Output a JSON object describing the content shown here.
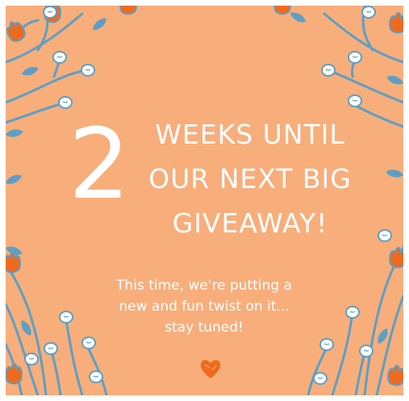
{
  "card": {
    "number": "2",
    "headline_lines": [
      "WEEKS UNTIL",
      "OUR NEXT BIG",
      "GIVEAWAY!"
    ],
    "subtext_lines": [
      "This time, we're putting a",
      "new and fun twist on it...",
      "stay tuned!"
    ]
  },
  "colors": {
    "background": "#f7ae7b",
    "text": "#ffffff",
    "vine": "#5d9fc4",
    "flower": "#ef6a1d",
    "berry": "#ffffff",
    "heart": "#ef6a1d"
  },
  "icons": {
    "heart": "heart-icon",
    "decoration": "floral-vine-border"
  }
}
